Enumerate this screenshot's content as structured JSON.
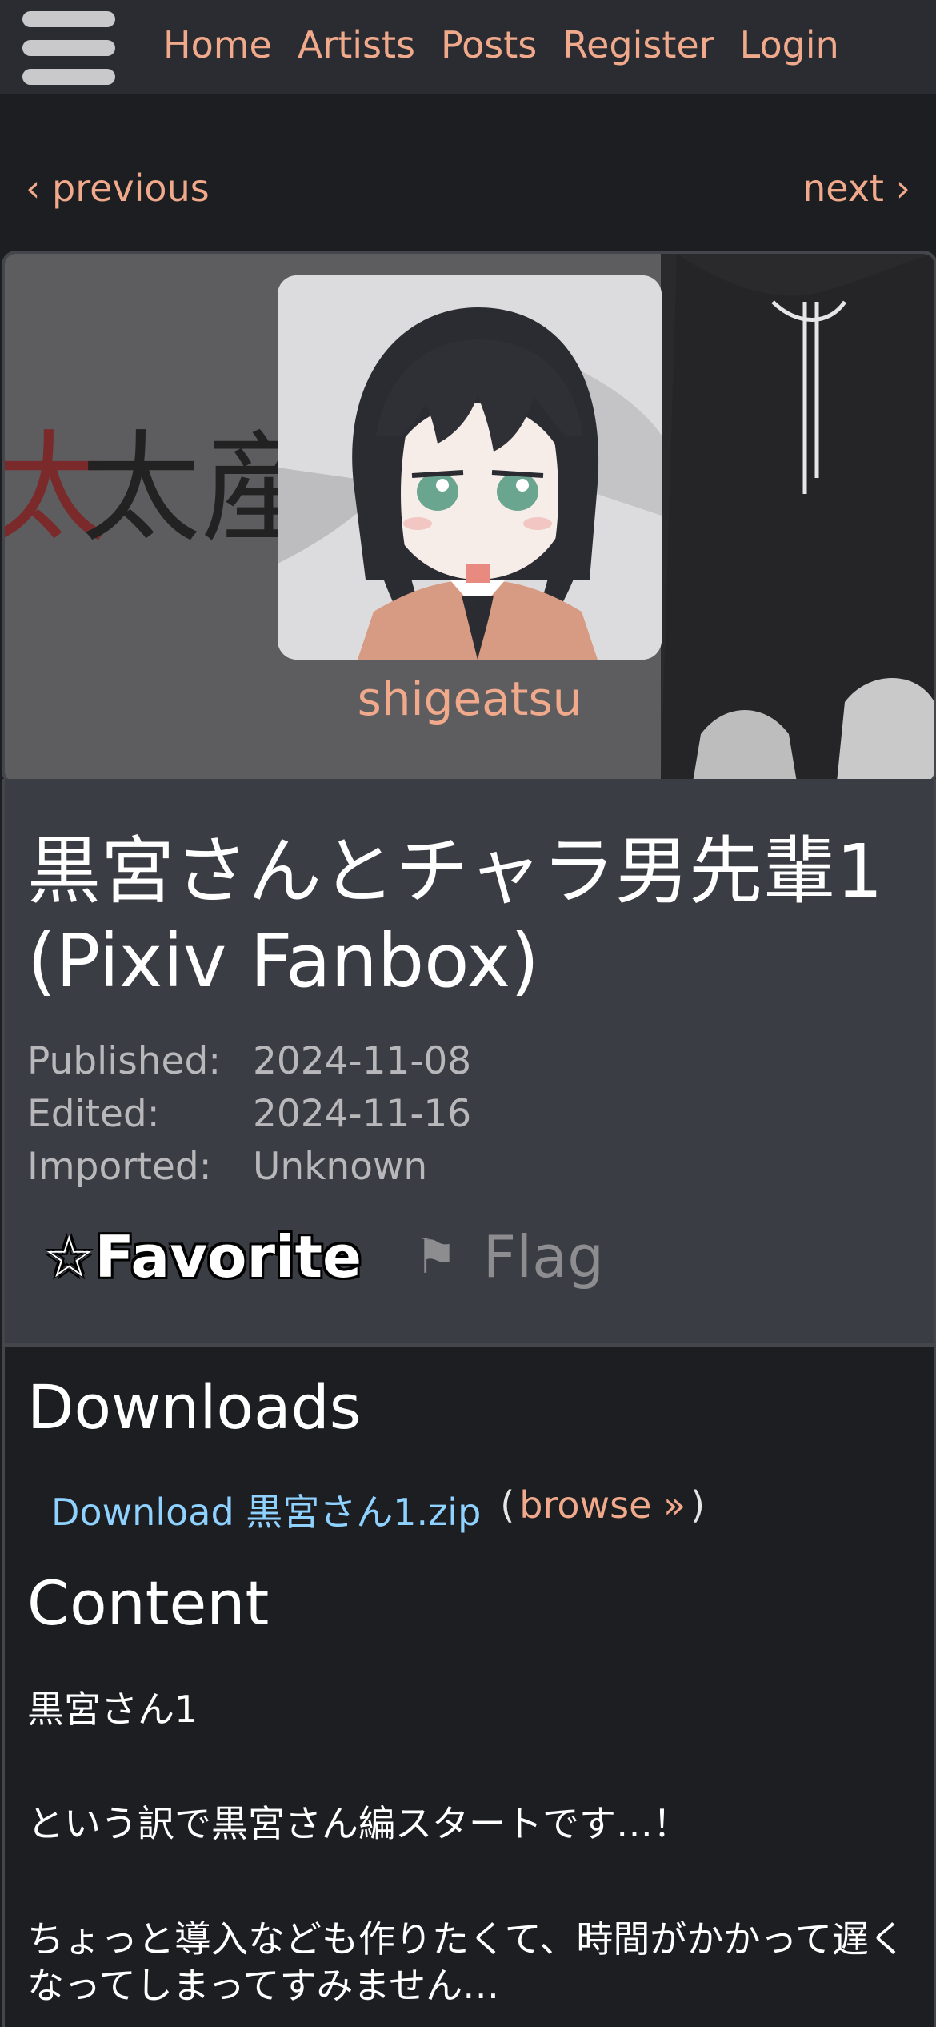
{
  "nav": {
    "links": [
      "Home",
      "Artists",
      "Posts",
      "Register",
      "Login"
    ]
  },
  "pager": {
    "previous": "‹ previous",
    "next": "next ›"
  },
  "artist": {
    "name": "shigeatsu",
    "banner_text": "太産業"
  },
  "post": {
    "title": "黒宮さんとチャラ男先輩1 (Pixiv Fanbox)",
    "meta": [
      {
        "label": "Published:",
        "value": "2024-11-08"
      },
      {
        "label": "Edited:",
        "value": "2024-11-16"
      },
      {
        "label": "Imported:",
        "value": "Unknown"
      }
    ],
    "favorite_label": "☆Favorite",
    "flag_label": "Flag"
  },
  "downloads": {
    "heading": "Downloads",
    "file_link": "Download 黒宮さん1.zip",
    "paren_open": "(",
    "browse": "browse »",
    "paren_close": ")"
  },
  "content": {
    "heading": "Content",
    "paragraphs": [
      "黒宮さん1",
      "という訳で黒宮さん編スタートです…！",
      "ちょっと導入なども作りたくて、時間がかかって遅くなってしまってすみません…"
    ]
  },
  "colors": {
    "link": "#f0a98b",
    "download_link": "#8fd1ff",
    "background": "#1d1e21",
    "card": "#3b3d45"
  }
}
